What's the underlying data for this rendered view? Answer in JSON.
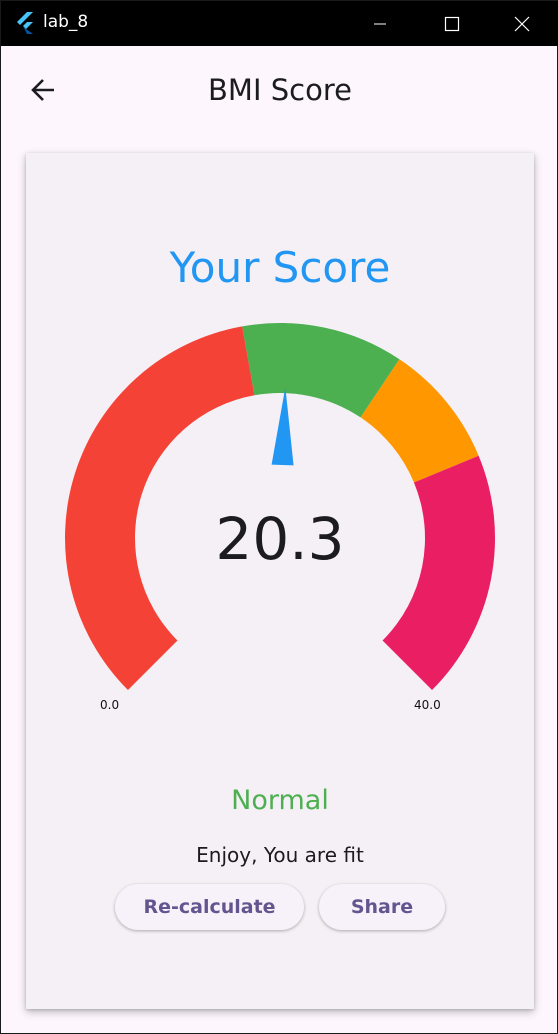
{
  "window": {
    "title": "lab_8",
    "controls": [
      "minimize-icon",
      "maximize-icon",
      "close-icon"
    ]
  },
  "appbar": {
    "title": "BMI Score",
    "back_icon": "arrow-back-icon"
  },
  "score": {
    "heading": "Your Score",
    "value": "20.3",
    "status": "Normal",
    "message": "Enjoy, You are fit"
  },
  "gauge": {
    "min_label": "0.0",
    "max_label": "40.0",
    "min": 0,
    "max": 40,
    "value": 20.3,
    "ranges": [
      {
        "from": 0,
        "to": 18.5,
        "color": "#f44336"
      },
      {
        "from": 18.5,
        "to": 25,
        "color": "#4caf50"
      },
      {
        "from": 25,
        "to": 30,
        "color": "#ff9800"
      },
      {
        "from": 30,
        "to": 40,
        "color": "#e91e63"
      }
    ],
    "pointer_color": "#2196f3"
  },
  "buttons": {
    "recalculate": "Re-calculate",
    "share": "Share"
  },
  "colors": {
    "heading": "#2196f3",
    "status": "#4caf50",
    "button_text": "#65558f"
  }
}
